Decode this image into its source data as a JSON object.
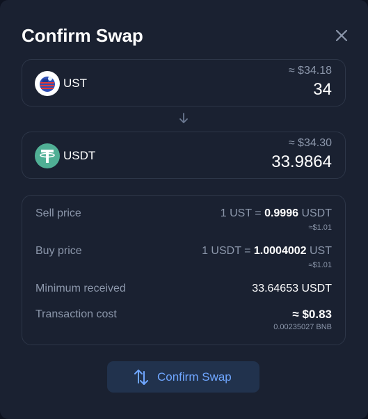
{
  "modal": {
    "title": "Confirm Swap",
    "close_icon": "close-icon"
  },
  "from_token": {
    "symbol": "UST",
    "usd_estimate": "≈ $34.18",
    "amount": "34",
    "icon": "ust-token-icon"
  },
  "to_token": {
    "symbol": "USDT",
    "usd_estimate": "≈ $34.30",
    "amount": "33.9864",
    "icon": "usdt-token-icon"
  },
  "arrow_icon": "arrow-down-icon",
  "details": {
    "sell_price": {
      "label": "Sell price",
      "prefix": "1 UST = ",
      "rate": "0.9996",
      "unit": " USDT",
      "usd": "≈$1.01"
    },
    "buy_price": {
      "label": "Buy price",
      "prefix": "1 USDT = ",
      "rate": "1.0004002",
      "unit": " UST",
      "usd": "≈$1.01"
    },
    "minimum_received": {
      "label": "Minimum received",
      "value": "33.64653 USDT"
    },
    "transaction_cost": {
      "label": "Transaction cost",
      "value": "≈ $0.83",
      "sub": "0.00235027 BNB"
    }
  },
  "confirm_button": {
    "label": "Confirm Swap",
    "icon": "swap-arrows-icon"
  },
  "colors": {
    "background": "#1a2131",
    "border": "#2d3648",
    "muted_text": "#8c97ab",
    "accent": "#6fa6ff",
    "button_bg": "#21324d",
    "usdt_green": "#50af95"
  }
}
